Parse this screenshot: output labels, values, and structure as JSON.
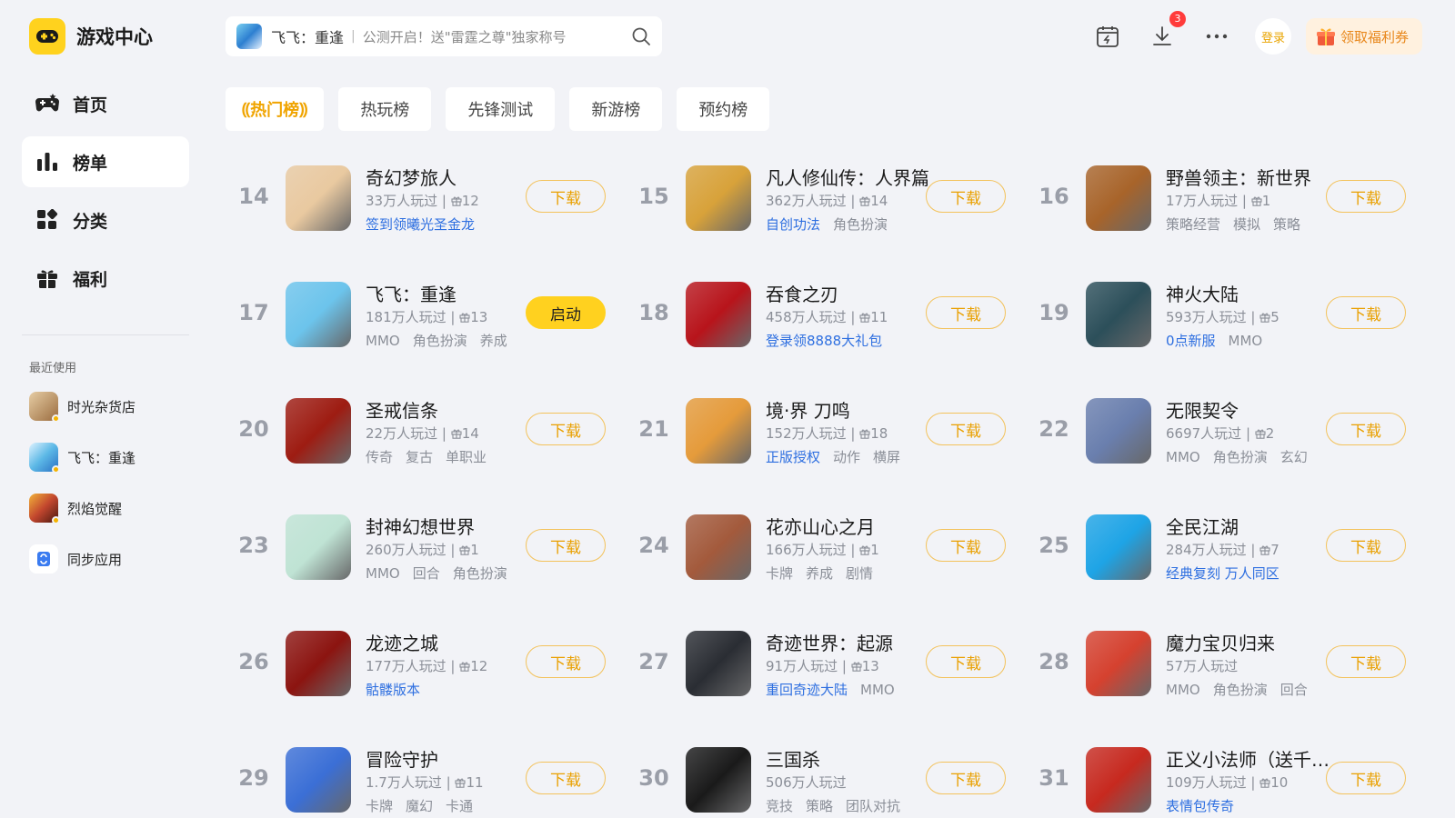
{
  "app": {
    "title": "游戏中心",
    "colors": {
      "accent": "#ffd21e",
      "highlight_tag": "#2e6fe0",
      "button_border": "#f3c25b"
    }
  },
  "nav": [
    {
      "label": "首页",
      "icon": "gamepad-icon",
      "active": false
    },
    {
      "label": "榜单",
      "icon": "bar-chart-icon",
      "active": true
    },
    {
      "label": "分类",
      "icon": "category-icon",
      "active": false
    },
    {
      "label": "福利",
      "icon": "gift-icon",
      "active": false
    }
  ],
  "recent": {
    "title": "最近使用",
    "items": [
      {
        "label": "时光杂货店",
        "color": "#c9a277"
      },
      {
        "label": "飞飞：重逢",
        "color": "#5cb8e6"
      },
      {
        "label": "烈焰觉醒",
        "color": "#c2462e"
      },
      {
        "label": "同步应用",
        "color": "#3a7bf0"
      }
    ]
  },
  "search": {
    "game": "飞飞：重逢",
    "separator": "|",
    "hint": "公测开启！送\"雷霆之尊\"独家称号"
  },
  "header": {
    "download_badge": "3",
    "login": "登录",
    "coupon": "领取福利券"
  },
  "tabs": [
    {
      "label": "热门榜",
      "active": true
    },
    {
      "label": "热玩榜",
      "active": false
    },
    {
      "label": "先锋测试",
      "active": false
    },
    {
      "label": "新游榜",
      "active": false
    },
    {
      "label": "预约榜",
      "active": false
    }
  ],
  "games": [
    {
      "rank": "14",
      "name": "奇幻梦旅人",
      "players": "33万人玩过",
      "gifts": "12",
      "tags": [
        {
          "t": "签到领曦光圣金龙",
          "hi": true
        }
      ],
      "button": "下载",
      "color": "#e9c9a0"
    },
    {
      "rank": "15",
      "name": "凡人修仙传：人界篇",
      "players": "362万人玩过",
      "gifts": "14",
      "tags": [
        {
          "t": "自创功法",
          "hi": true
        },
        {
          "t": "角色扮演",
          "hi": false
        }
      ],
      "button": "下载",
      "color": "#d8a23a"
    },
    {
      "rank": "16",
      "name": "野兽领主：新世界",
      "players": "17万人玩过",
      "gifts": "1",
      "tags": [
        {
          "t": "策略经营",
          "hi": false
        },
        {
          "t": "模拟",
          "hi": false
        },
        {
          "t": "策略",
          "hi": false
        }
      ],
      "button": "下载",
      "color": "#a8642a"
    },
    {
      "rank": "17",
      "name": "飞飞：重逢",
      "players": "181万人玩过",
      "gifts": "13",
      "tags": [
        {
          "t": "MMO",
          "hi": false
        },
        {
          "t": "角色扮演",
          "hi": false
        },
        {
          "t": "养成",
          "hi": false
        }
      ],
      "button": "启动",
      "color": "#6cc4ec"
    },
    {
      "rank": "18",
      "name": "吞食之刃",
      "players": "458万人玩过",
      "gifts": "11",
      "tags": [
        {
          "t": "登录领8888大礼包",
          "hi": true
        }
      ],
      "button": "下载",
      "color": "#b8141b"
    },
    {
      "rank": "19",
      "name": "神火大陆",
      "players": "593万人玩过",
      "gifts": "5",
      "tags": [
        {
          "t": "0点新服",
          "hi": true
        },
        {
          "t": "MMO",
          "hi": false
        }
      ],
      "button": "下载",
      "color": "#2c4f5a"
    },
    {
      "rank": "20",
      "name": "圣戒信条",
      "players": "22万人玩过",
      "gifts": "14",
      "tags": [
        {
          "t": "传奇",
          "hi": false
        },
        {
          "t": "复古",
          "hi": false
        },
        {
          "t": "单职业",
          "hi": false
        }
      ],
      "button": "下载",
      "color": "#9e1c12"
    },
    {
      "rank": "21",
      "name": "境·界 刀鸣",
      "players": "152万人玩过",
      "gifts": "18",
      "tags": [
        {
          "t": "正版授权",
          "hi": true
        },
        {
          "t": "动作",
          "hi": false
        },
        {
          "t": "横屏",
          "hi": false
        }
      ],
      "button": "下载",
      "color": "#e59b3b"
    },
    {
      "rank": "22",
      "name": "无限契令",
      "players": "6697人玩过",
      "gifts": "2",
      "tags": [
        {
          "t": "MMO",
          "hi": false
        },
        {
          "t": "角色扮演",
          "hi": false
        },
        {
          "t": "玄幻",
          "hi": false
        }
      ],
      "button": "下载",
      "color": "#6a7fae"
    },
    {
      "rank": "23",
      "name": "封神幻想世界",
      "players": "260万人玩过",
      "gifts": "1",
      "tags": [
        {
          "t": "MMO",
          "hi": false
        },
        {
          "t": "回合",
          "hi": false
        },
        {
          "t": "角色扮演",
          "hi": false
        }
      ],
      "button": "下载",
      "color": "#bfe3d4"
    },
    {
      "rank": "24",
      "name": "花亦山心之月",
      "players": "166万人玩过",
      "gifts": "1",
      "tags": [
        {
          "t": "卡牌",
          "hi": false
        },
        {
          "t": "养成",
          "hi": false
        },
        {
          "t": "剧情",
          "hi": false
        }
      ],
      "button": "下载",
      "color": "#a35a3c"
    },
    {
      "rank": "25",
      "name": "全民江湖",
      "players": "284万人玩过",
      "gifts": "7",
      "tags": [
        {
          "t": "经典复刻 万人同区",
          "hi": true
        }
      ],
      "button": "下载",
      "color": "#1ea4e6"
    },
    {
      "rank": "26",
      "name": "龙迹之城",
      "players": "177万人玩过",
      "gifts": "12",
      "tags": [
        {
          "t": "骷髅版本",
          "hi": true
        }
      ],
      "button": "下载",
      "color": "#8c1410"
    },
    {
      "rank": "27",
      "name": "奇迹世界：起源",
      "players": "91万人玩过",
      "gifts": "13",
      "tags": [
        {
          "t": "重回奇迹大陆",
          "hi": true
        },
        {
          "t": "MMO",
          "hi": false
        }
      ],
      "button": "下载",
      "color": "#2a2d33"
    },
    {
      "rank": "28",
      "name": "魔力宝贝归来",
      "players": "57万人玩过",
      "gifts": "",
      "tags": [
        {
          "t": "MMO",
          "hi": false
        },
        {
          "t": "角色扮演",
          "hi": false
        },
        {
          "t": "回合",
          "hi": false
        }
      ],
      "button": "下载",
      "color": "#d5412f"
    },
    {
      "rank": "29",
      "name": "冒险守护",
      "players": "1.7万人玩过",
      "gifts": "11",
      "tags": [
        {
          "t": "卡牌",
          "hi": false
        },
        {
          "t": "魔幻",
          "hi": false
        },
        {
          "t": "卡通",
          "hi": false
        }
      ],
      "button": "下载",
      "color": "#3b6fd6"
    },
    {
      "rank": "30",
      "name": "三国杀",
      "players": "506万人玩过",
      "gifts": "",
      "tags": [
        {
          "t": "竞技",
          "hi": false
        },
        {
          "t": "策略",
          "hi": false
        },
        {
          "t": "团队对抗",
          "hi": false
        }
      ],
      "button": "下载",
      "color": "#1a1a1a"
    },
    {
      "rank": "31",
      "name": "正义小法师（送千抽）",
      "players": "109万人玩过",
      "gifts": "10",
      "tags": [
        {
          "t": "表情包传奇",
          "hi": true
        }
      ],
      "button": "下载",
      "color": "#c7291f"
    }
  ]
}
